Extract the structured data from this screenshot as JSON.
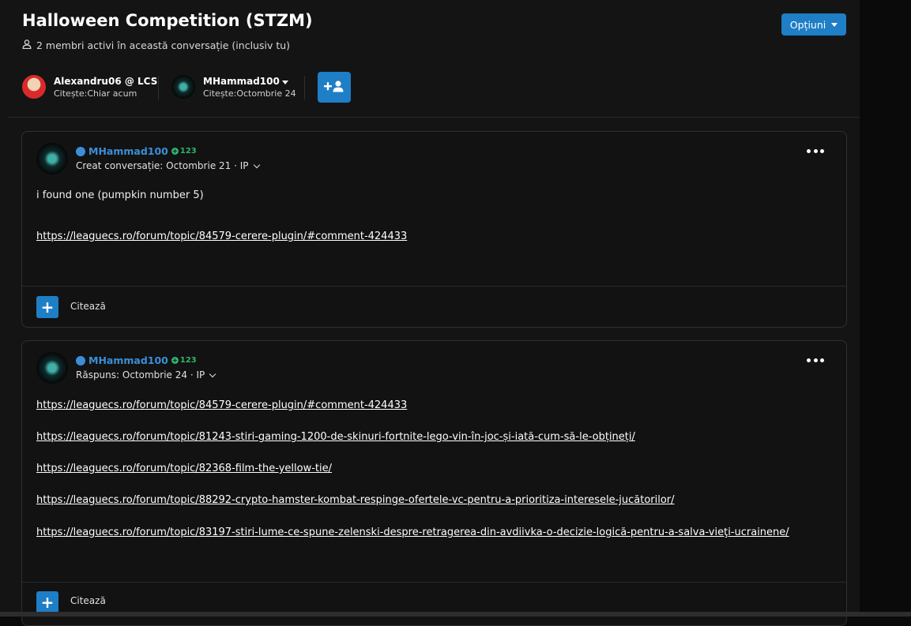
{
  "header": {
    "title": "Halloween Competition (STZM)",
    "active_members": "2 membri activi în această conversație (inclusiv tu)",
    "options_label": "Opțiuni",
    "participants": [
      {
        "name": "Alexandru06 @ LCS",
        "status": "Citește:Chiar acum"
      },
      {
        "name": "MHammad100",
        "status": "Citește:Octombrie 24"
      }
    ]
  },
  "posts": [
    {
      "author": "MHammad100",
      "reputation": "123",
      "meta": "Creat conversație: Octombrie 21 · IP",
      "text": "i found one (pumpkin number 5)",
      "links": [
        "https://leaguecs.ro/forum/topic/84579-cerere-plugin/#comment-424433"
      ],
      "quote_label": "Citează"
    },
    {
      "author": "MHammad100",
      "reputation": "123",
      "meta": "Răspuns: Octombrie 24 · IP",
      "links": [
        "https://leaguecs.ro/forum/topic/84579-cerere-plugin/#comment-424433",
        "https://leaguecs.ro/forum/topic/81243-stiri-gaming-1200-de-skinuri-fortnite-lego-vin-în-joc-și-iată-cum-să-le-obțineți/",
        "https://leaguecs.ro/forum/topic/82368-film-the-yellow-tie/",
        "https://leaguecs.ro/forum/topic/88292-crypto-hamster-kombat-respinge-ofertele-vc-pentru-a-prioritiza-interesele-jucătorilor/",
        "https://leaguecs.ro/forum/topic/83197-stiri-lume-ce-spune-zelenski-despre-retragerea-din-avdiivka-o-decizie-logică-pentru-a-salva-vieţi-ucrainene/"
      ],
      "quote_label": "Citează"
    }
  ],
  "colors": {
    "accent": "#1e7ec6",
    "author": "#3a8fd9",
    "reputation": "#2fb36b"
  },
  "icons": [
    "user-icon",
    "caret-down-icon",
    "add-user-icon",
    "steam-icon",
    "reputation-plus-icon",
    "chevron-down-icon",
    "more-options-icon",
    "plus-icon"
  ]
}
